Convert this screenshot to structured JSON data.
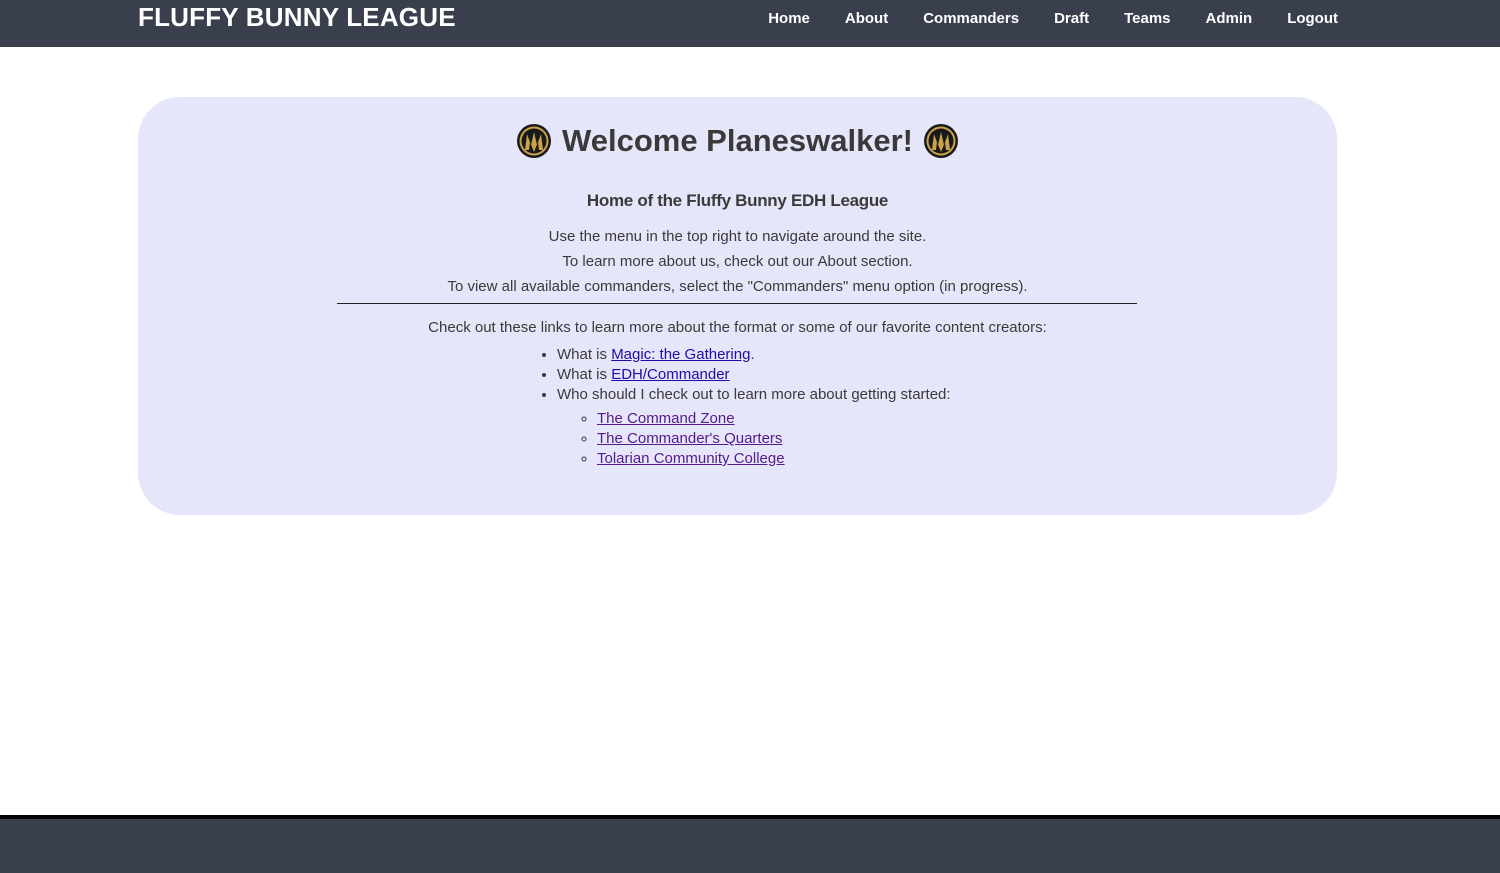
{
  "header": {
    "site_title": "FLUFFY BUNNY LEAGUE",
    "nav": [
      {
        "label": "Home"
      },
      {
        "label": "About"
      },
      {
        "label": "Commanders"
      },
      {
        "label": "Draft"
      },
      {
        "label": "Teams"
      },
      {
        "label": "Admin"
      },
      {
        "label": "Logout"
      }
    ]
  },
  "main": {
    "title": "Welcome Planeswalker!",
    "icon": "mtg-planeswalker-icon",
    "subtitle": "Home of the Fluffy Bunny EDH League",
    "intro_lines": [
      "Use the menu in the top right to navigate around the site.",
      "To learn more about us, check out our About section.",
      "To view all available commanders, select the \"Commanders\" menu option (in progress)."
    ],
    "links_intro": "Check out these links to learn more about the format or some of our favorite content creators:",
    "links": {
      "item1_prefix": "What is ",
      "item1_link": "Magic: the Gathering",
      "item1_suffix": ".",
      "item2_prefix": "What is ",
      "item2_link": "EDH/Commander",
      "item3_text": "Who should I check out to learn more about getting started:",
      "creators": [
        {
          "label": "The Command Zone"
        },
        {
          "label": "The Commander's Quarters"
        },
        {
          "label": "Tolarian Community College"
        }
      ]
    }
  },
  "colors": {
    "header_bg": "#3a3f4e",
    "card_bg": "#e6e6fa",
    "link": "#1a0dab",
    "visited_link": "#551a8b"
  }
}
